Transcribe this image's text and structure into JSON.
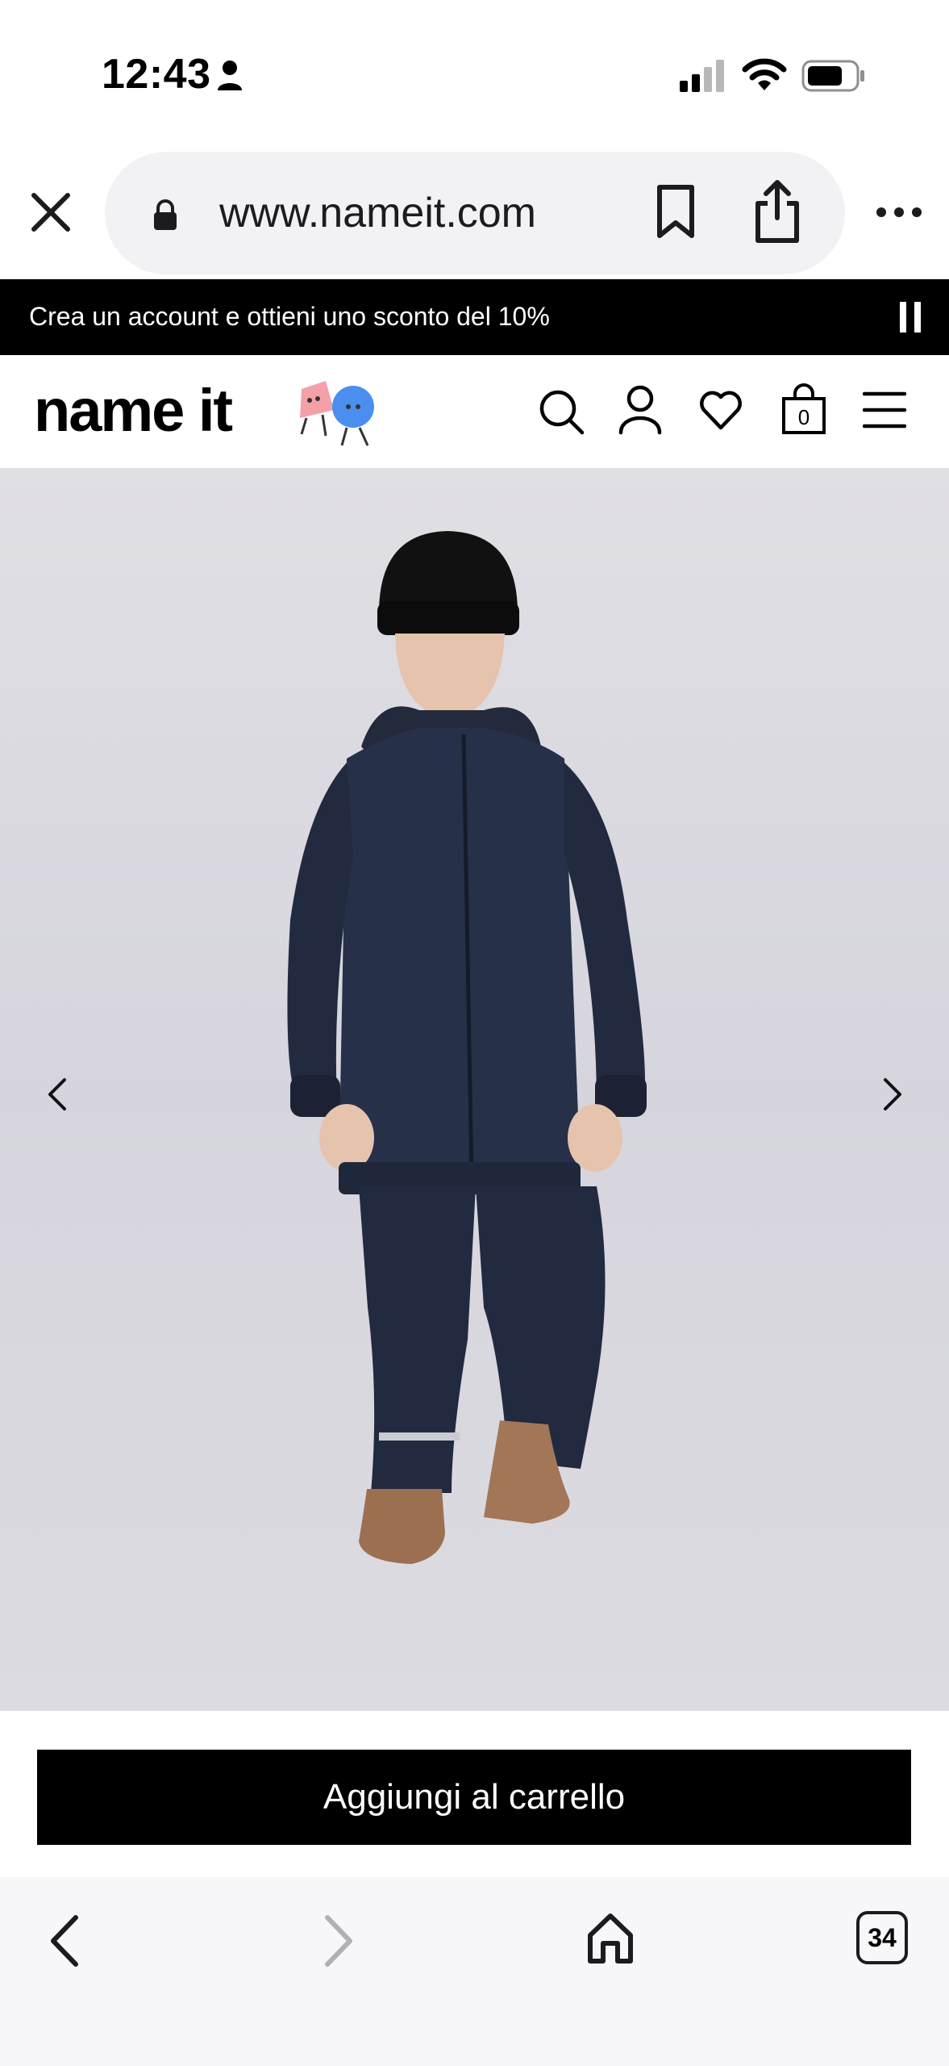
{
  "status_bar": {
    "time": "12:43"
  },
  "browser": {
    "url": "www.nameit.com",
    "tabs_count": "34"
  },
  "promo": {
    "text": "Crea un account e ottieni uno sconto del 10%"
  },
  "header": {
    "logo": "name it",
    "cart_count": "0"
  },
  "product": {
    "add_to_cart_label": "Aggiungi al carrello"
  },
  "icons": {
    "close": "close-icon",
    "lock": "lock-icon",
    "bookmark": "bookmark-icon",
    "share": "share-icon",
    "more": "more-icon",
    "search": "search-icon",
    "account": "account-icon",
    "wishlist": "heart-icon",
    "cart": "bag-icon",
    "menu": "hamburger-icon",
    "back": "chevron-left-icon",
    "forward": "chevron-right-icon",
    "home": "home-icon"
  },
  "colors": {
    "promo_bg": "#000000",
    "button_bg": "#000000",
    "mascot_pink": "#f4a0a8",
    "mascot_blue": "#4a8ff0"
  }
}
